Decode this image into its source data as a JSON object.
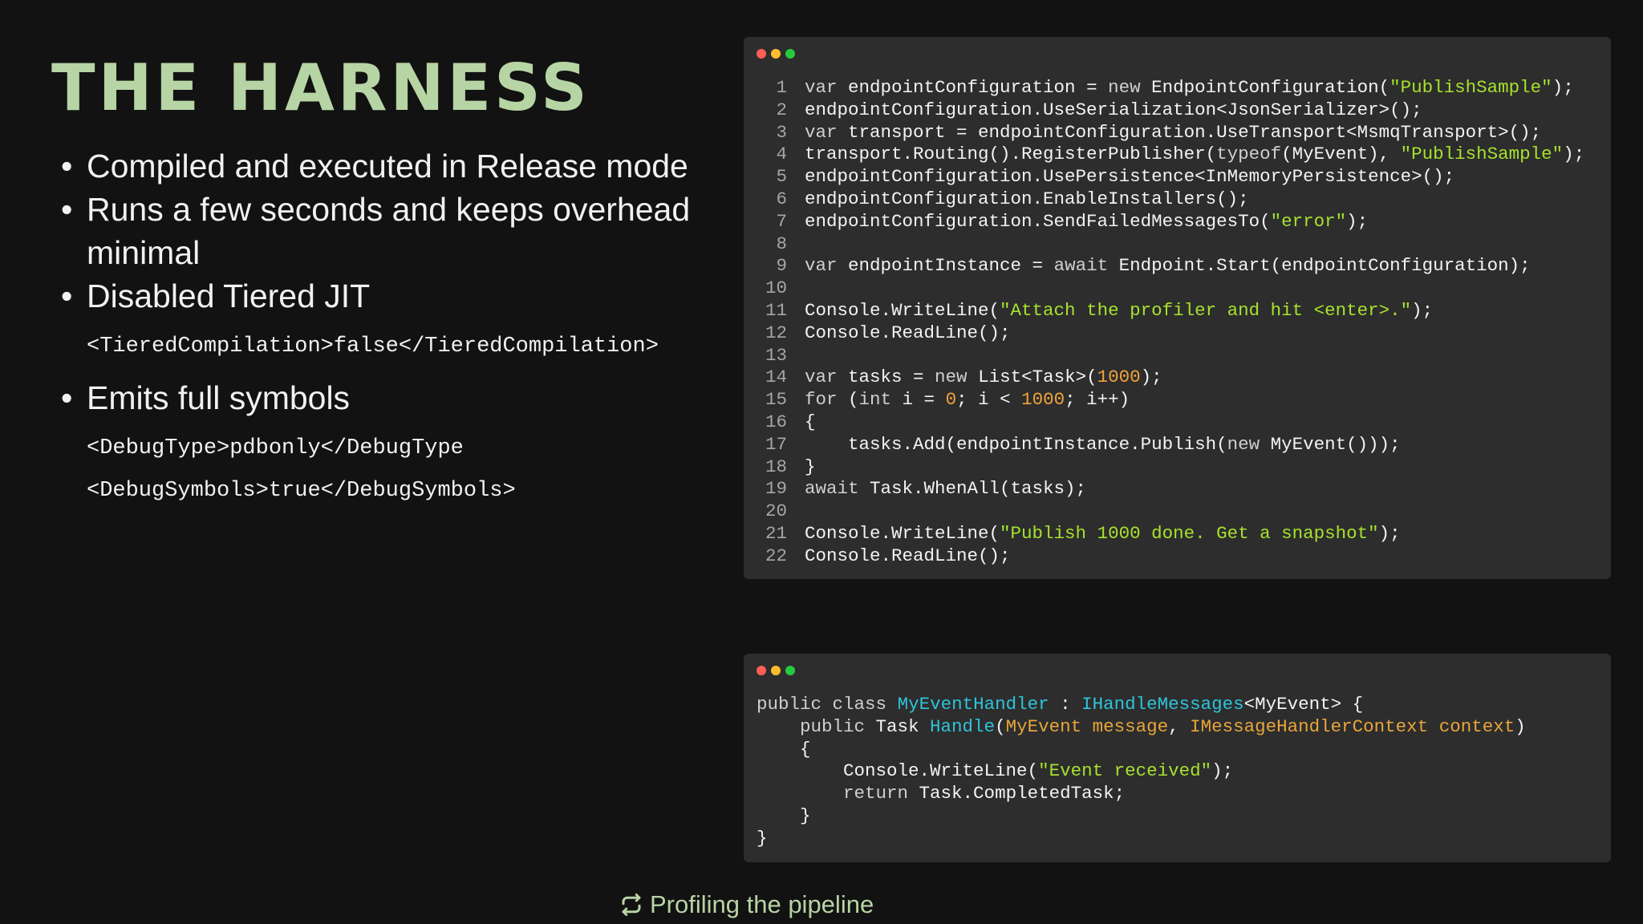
{
  "slide": {
    "title": "THE HARNESS",
    "bullets": [
      "Compiled and executed in Release mode",
      "Runs a few seconds and keeps overhead minimal",
      "Disabled Tiered JIT",
      "Emits full symbols"
    ],
    "code_snippets": [
      "<TieredCompilation>false</TieredCompilation>",
      "<DebugType>pdbonly</DebugType",
      "<DebugSymbols>true</DebugSymbols>"
    ]
  },
  "code_window_1": {
    "line_numbers": [
      "1",
      "2",
      "3",
      "4",
      "5",
      "6",
      "7",
      "8",
      "9",
      "10",
      "11",
      "12",
      "13",
      "14",
      "15",
      "16",
      "17",
      "18",
      "19",
      "20",
      "21",
      "22"
    ],
    "lines": [
      "var endpointConfiguration = new EndpointConfiguration(\"PublishSample\");",
      "endpointConfiguration.UseSerialization<JsonSerializer>();",
      "var transport = endpointConfiguration.UseTransport<MsmqTransport>();",
      "transport.Routing().RegisterPublisher(typeof(MyEvent), \"PublishSample\");",
      "endpointConfiguration.UsePersistence<InMemoryPersistence>();",
      "endpointConfiguration.EnableInstallers();",
      "endpointConfiguration.SendFailedMessagesTo(\"error\");",
      "",
      "var endpointInstance = await Endpoint.Start(endpointConfiguration);",
      "",
      "Console.WriteLine(\"Attach the profiler and hit <enter>.\");",
      "Console.ReadLine();",
      "",
      "var tasks = new List<Task>(1000);",
      "for (int i = 0; i < 1000; i++)",
      "{",
      "    tasks.Add(endpointInstance.Publish(new MyEvent()));",
      "}",
      "await Task.WhenAll(tasks);",
      "",
      "Console.WriteLine(\"Publish 1000 done. Get a snapshot\");",
      "Console.ReadLine();"
    ]
  },
  "code_window_2": {
    "lines": [
      "public class MyEventHandler : IHandleMessages<MyEvent> {",
      "    public Task Handle(MyEvent message, IMessageHandlerContext context)",
      "    {",
      "        Console.WriteLine(\"Event received\");",
      "        return Task.CompletedTask;",
      "    }",
      "}"
    ]
  },
  "footer": {
    "label": "Profiling the pipeline",
    "icon": "refresh-icon"
  },
  "colors": {
    "title": "#b7d4a4",
    "background": "#121212",
    "code_bg": "#2d2d2d",
    "string": "#a6e22e",
    "number": "#f0a33a",
    "type": "#2ec3d9"
  }
}
